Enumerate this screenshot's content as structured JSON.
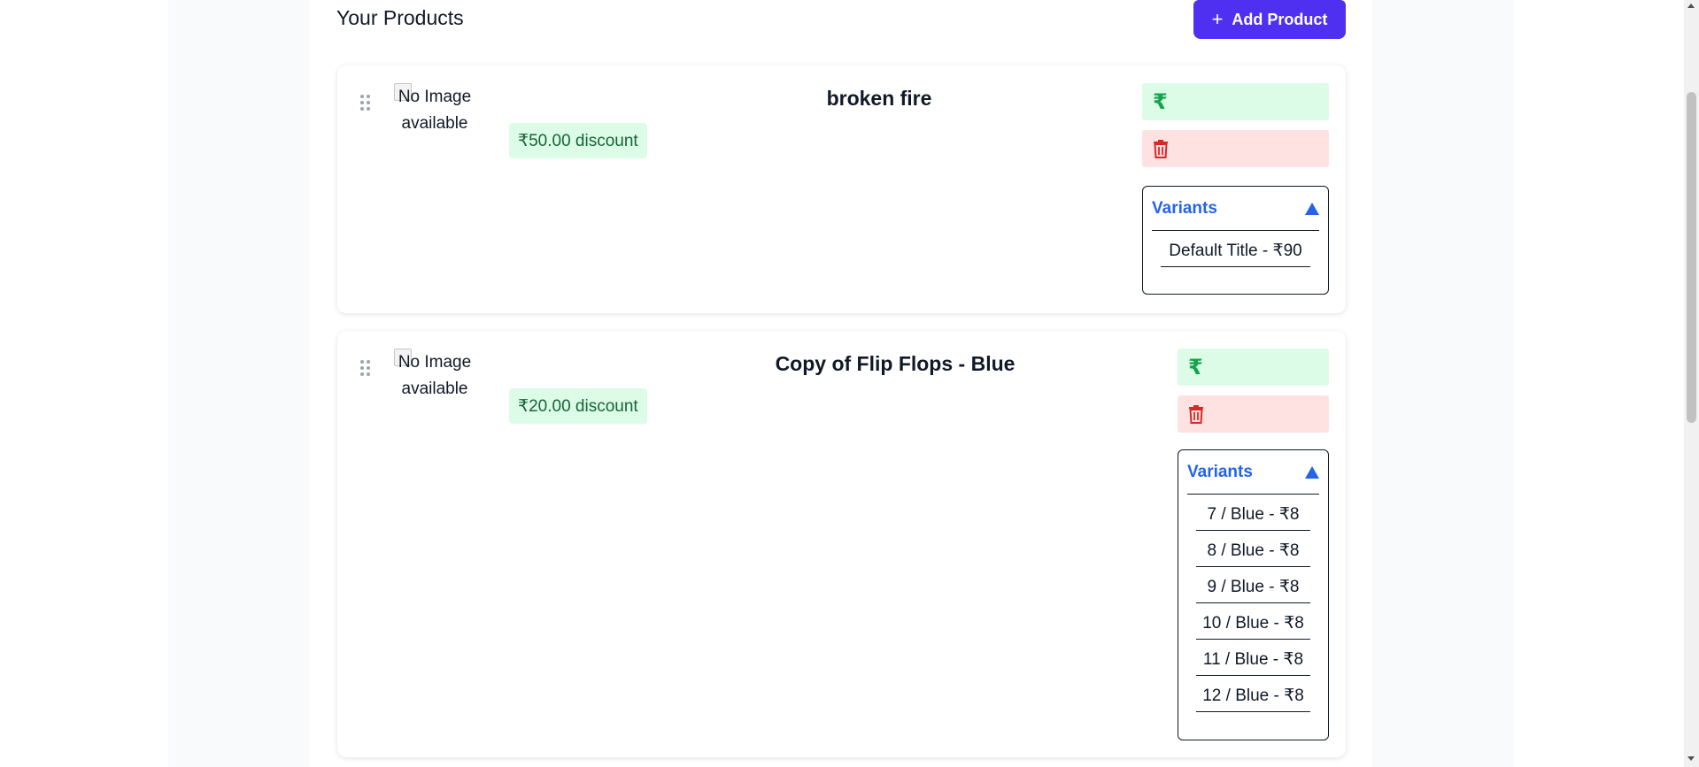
{
  "header": {
    "title": "Your Products",
    "add_button_label": "Add Product",
    "add_button_icon": "plus-icon"
  },
  "products": [
    {
      "image_alt": "No Image available",
      "discount": "₹50.00 discount",
      "title": "broken fire",
      "price_icon": "₹",
      "delete_icon": "trash-icon",
      "variants_label": "Variants",
      "variants": [
        "Default Title - ₹90"
      ]
    },
    {
      "image_alt": "No Image available",
      "discount": "₹20.00 discount",
      "title": "Copy of Flip Flops - Blue",
      "price_icon": "₹",
      "delete_icon": "trash-icon",
      "variants_label": "Variants",
      "variants": [
        "7 / Blue - ₹8",
        "8 / Blue - ₹8",
        "9 / Blue - ₹8",
        "10 / Blue - ₹8",
        "11 / Blue - ₹8",
        "12 / Blue - ₹8"
      ]
    }
  ],
  "colors": {
    "primary": "#4f2ff0",
    "discount_bg": "#dcfce7",
    "discount_text": "#166534",
    "delete_bg": "#fee2e2",
    "delete_icon": "#dc2626",
    "variants_accent": "#2563eb"
  }
}
